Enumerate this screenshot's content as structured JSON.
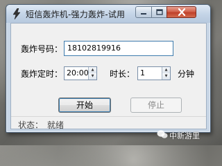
{
  "window": {
    "title": "短信轰炸机-强力轰炸-试用"
  },
  "form": {
    "phone_label": "轰炸号码：",
    "phone_value": "18102819916",
    "timer_label": "轰炸定时：",
    "timer_value": "20:00",
    "duration_label": "时长：",
    "duration_value": "1",
    "duration_unit": "分钟"
  },
  "buttons": {
    "start": "开始",
    "stop": "停止"
  },
  "status": {
    "label": "状态：",
    "value": "就绪"
  },
  "watermark": {
    "text": "中新游里"
  }
}
